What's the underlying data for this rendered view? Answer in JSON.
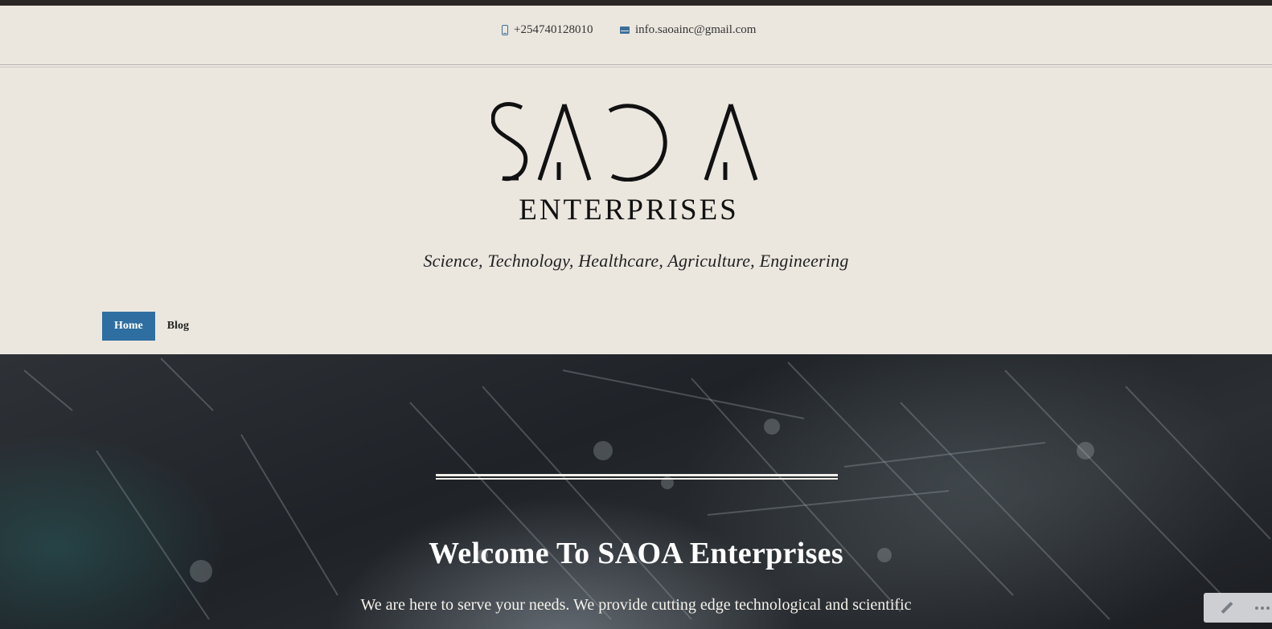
{
  "contact": {
    "phone": "+254740128010",
    "email": "info.saoainc@gmail.com",
    "phone_icon": "mobile-phone-icon",
    "email_icon": "envelope-icon"
  },
  "branding": {
    "logo_main": "SAOA",
    "logo_sub": "ENTERPRISES",
    "tagline": "Science, Technology, Healthcare, Agriculture, Engineering"
  },
  "nav": {
    "items": [
      {
        "label": "Home",
        "active": true
      },
      {
        "label": "Blog",
        "active": false
      }
    ]
  },
  "hero": {
    "title": "Welcome To SAOA Enterprises",
    "text": "We are here to serve your needs. We provide cutting edge technological and scientific"
  },
  "widget": {
    "edit_icon": "pencil-icon",
    "more_icon": "ellipsis-icon"
  },
  "colors": {
    "accent": "#2e6ea0",
    "background": "#ebe7df",
    "top_strip": "#2a2623"
  }
}
